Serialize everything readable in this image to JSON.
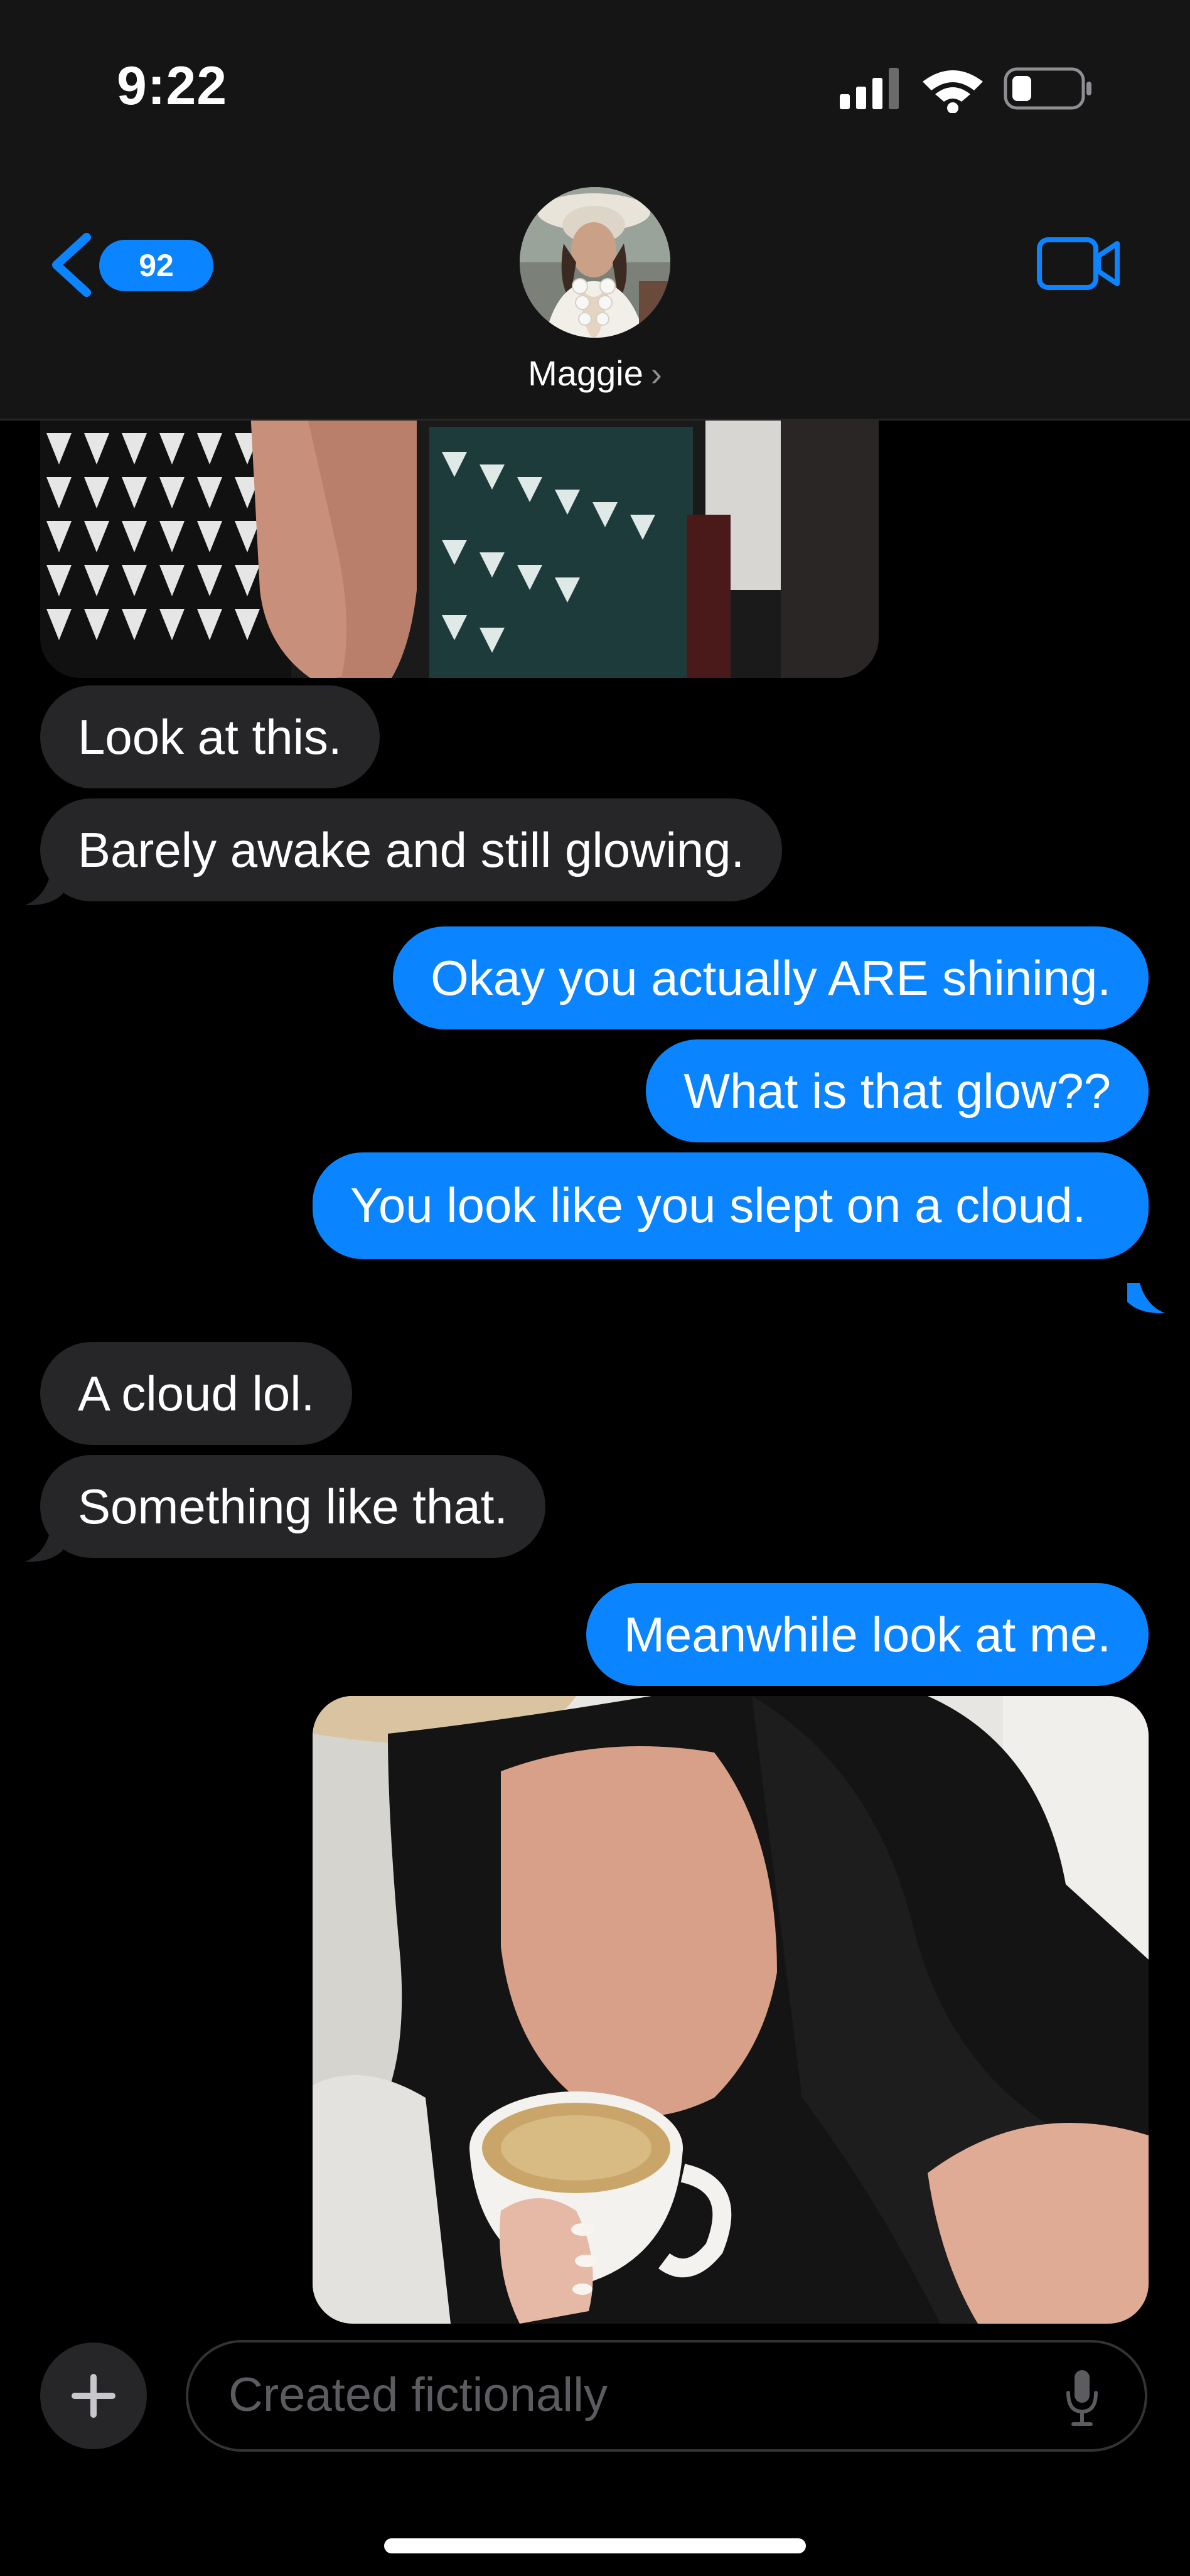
{
  "status_bar": {
    "time": "9:22"
  },
  "header": {
    "back_badge_count": "92",
    "contact_name": "Maggie",
    "chevron": "›"
  },
  "messages": [
    {
      "from": "them",
      "text": "Look at this."
    },
    {
      "from": "them",
      "text": "Barely awake and still glowing."
    },
    {
      "from": "me",
      "text": "Okay you actually ARE shining."
    },
    {
      "from": "me",
      "text": "What is that glow??"
    },
    {
      "from": "me",
      "text": "You look like you slept on a cloud."
    },
    {
      "from": "them",
      "text": "A cloud lol."
    },
    {
      "from": "them",
      "text": "Something like that."
    },
    {
      "from": "me",
      "text": "Meanwhile look at me."
    }
  ],
  "input": {
    "placeholder": "Created fictionally"
  },
  "icons": {
    "back": "chevron-left-icon",
    "video": "video-camera-icon",
    "plus": "plus-icon",
    "mic": "microphone-icon"
  },
  "colors": {
    "accent": "#0a84ff",
    "incoming_bubble": "#262628",
    "header_bg": "#151515"
  }
}
